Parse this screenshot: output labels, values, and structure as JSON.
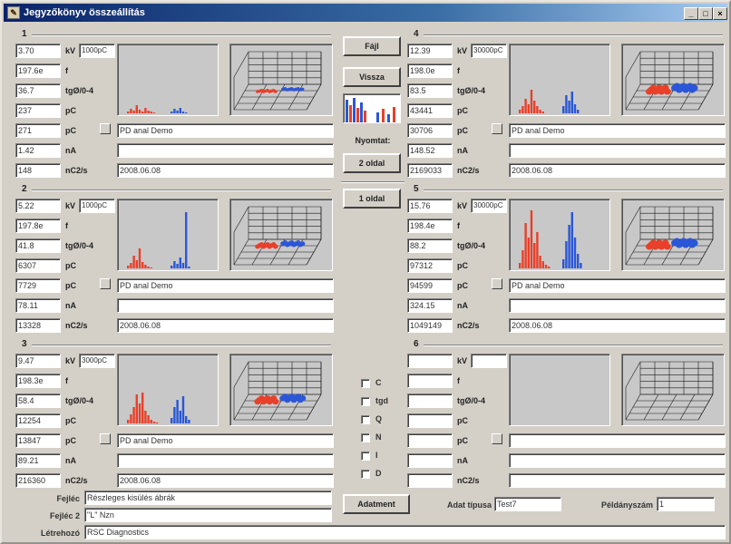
{
  "window": {
    "title": "Jegyzőkönyv összeállítás",
    "controls": [
      "_",
      "□",
      "×"
    ]
  },
  "colors": {
    "red": "#e8402a",
    "blue": "#2a56d8",
    "plot_bg": "#c8c8c8"
  },
  "panels": [
    {
      "number": "1",
      "values": [
        "3.70",
        "197.6e",
        "36.7",
        "237",
        "271",
        "1.42",
        "148"
      ],
      "scale": "1000pC",
      "name": "PD anal Demo",
      "date": "2008.06.08"
    },
    {
      "number": "2",
      "values": [
        "5.22",
        "197.8e",
        "41.8",
        "6307",
        "7729",
        "78.11",
        "13328"
      ],
      "scale": "1000pC",
      "name": "PD anal Demo",
      "date": "2008.06.08"
    },
    {
      "number": "3",
      "values": [
        "9.47",
        "198.3e",
        "58.4",
        "12254",
        "13847",
        "89.21",
        "216360"
      ],
      "scale": "3000pC",
      "name": "PD anal Demo",
      "date": "2008.06.08"
    },
    {
      "number": "4",
      "values": [
        "12.39",
        "198.0e",
        "83.5",
        "43441",
        "30706",
        "148.52",
        "2169033"
      ],
      "scale": "30000pC",
      "name": "PD anal Demo",
      "date": "2008.06.08"
    },
    {
      "number": "5",
      "values": [
        "15.76",
        "198.4e",
        "88.2",
        "97312",
        "94599",
        "324.15",
        "1049149"
      ],
      "scale": "30000pC",
      "name": "PD anal Demo",
      "date": "2008.06.08"
    },
    {
      "number": "6",
      "values": [
        "",
        "",
        "",
        "",
        "",
        "",
        ""
      ],
      "scale": "",
      "name": "",
      "date": ""
    }
  ],
  "units": [
    "kV",
    "f",
    "tgØ/0-4",
    "pC",
    "pC",
    "nA",
    "nC2/s"
  ],
  "center": {
    "file_button": "Fájl",
    "back_button": "Vissza",
    "print_label": "Nyomtat:",
    "page2_button": "2 oldal",
    "page1_button": "1 oldal",
    "checkboxes": [
      "C",
      "tgd",
      "Q",
      "N",
      "I",
      "D"
    ],
    "data_button": "Adatment"
  },
  "bottom": {
    "label1": "Fejléc",
    "value1": "Részleges kisülés ábrák",
    "label2": "Fejléc 2",
    "value2": "\"L\" Nzn",
    "label3": "Létrehozó",
    "value3": "RSC Diagnostics",
    "data_type_label": "Adat típusa",
    "data_type_value": "Test7",
    "copies_label": "Példányszám",
    "copies_value": "1"
  }
}
